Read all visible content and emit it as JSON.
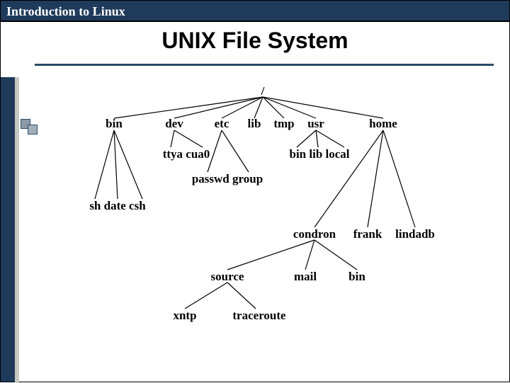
{
  "header": {
    "title": "Introduction to Linux"
  },
  "slide": {
    "title": "UNIX File System"
  },
  "tree": {
    "root": "/",
    "level1": [
      "bin",
      "dev",
      "etc",
      "lib",
      "tmp",
      "usr",
      "home"
    ],
    "bin_children": "sh date csh",
    "dev_children": "ttya cua0",
    "etc_children": "passwd  group",
    "usr_children": "bin lib local",
    "home_children": [
      "condron",
      "frank",
      "lindadb"
    ],
    "condron_children": [
      "source",
      "mail",
      "bin"
    ],
    "source_children": [
      "xntp",
      "traceroute"
    ]
  }
}
